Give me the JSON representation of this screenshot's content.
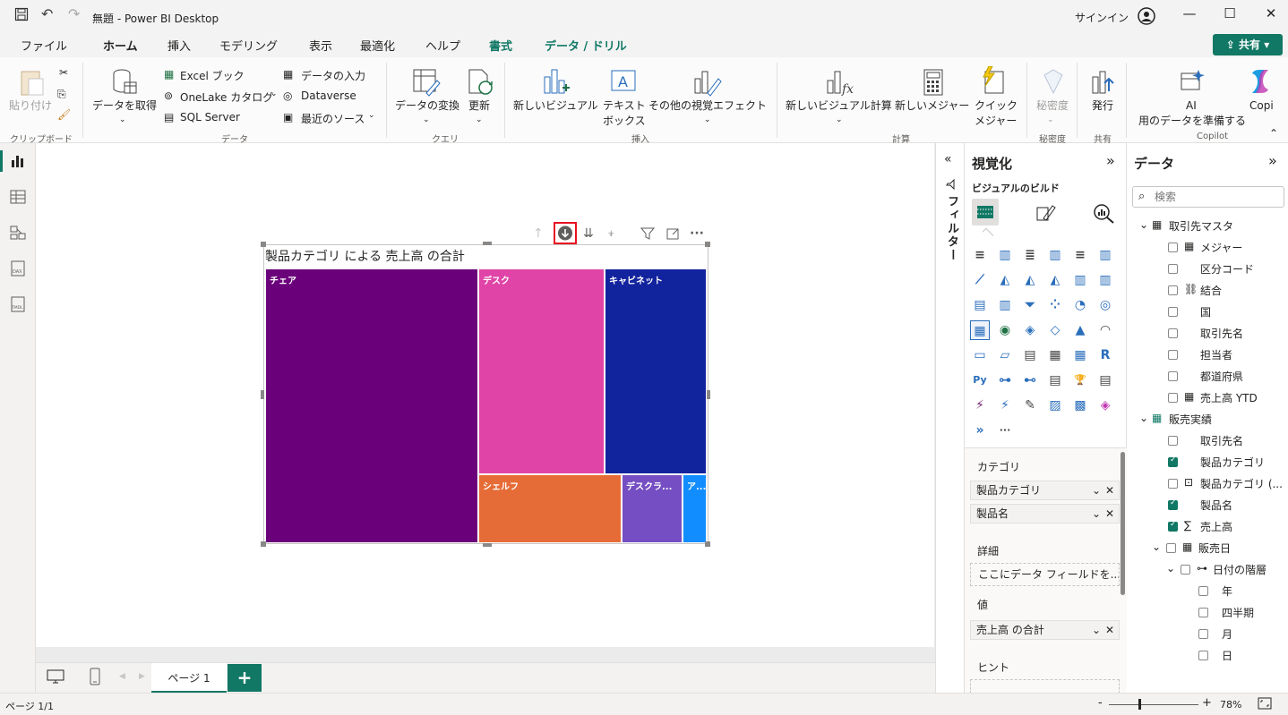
{
  "app": {
    "title": "無題 - Power BI Desktop",
    "signin": "サインイン"
  },
  "tabs": [
    "ファイル",
    "ホーム",
    "挿入",
    "モデリング",
    "表示",
    "最適化",
    "ヘルプ",
    "書式",
    "データ / ドリル"
  ],
  "share_label": "共有",
  "ribbon": {
    "paste": "貼り付け",
    "get_data": "データを取得",
    "excel": "Excel ブック",
    "onelake": "OneLake カタログ",
    "sql": "SQL Server",
    "enter_data": "データの入力",
    "dataverse": "Dataverse",
    "recent": "最近のソース",
    "transform": "データの変換",
    "refresh": "更新",
    "new_visual": "新しいビジュアル",
    "textbox_1": "テキスト",
    "textbox_2": "ボックス",
    "more_visuals": "その他の視覚エフェクト",
    "new_visual_calc": "新しいビジュアル計算",
    "new_measure": "新しいメジャー",
    "quick_measure_1": "クイック",
    "quick_measure_2": "メジャー",
    "sensitivity": "秘密度",
    "publish": "発行",
    "ai_1": "AI",
    "ai_2": "用のデータを準備する",
    "copilot": "Copi",
    "groups": {
      "clipboard": "クリップボード",
      "data": "データ",
      "query": "クエリ",
      "insert": "挿入",
      "calc": "計算",
      "sensitivity": "秘密度",
      "share": "共有",
      "copilot": "Copilot"
    }
  },
  "visual": {
    "title": "製品カテゴリ による 売上高 の合計",
    "tiles": [
      "チェア",
      "デスク",
      "キャビネット",
      "シェルフ",
      "デスクラ...",
      "ア..."
    ],
    "colors": [
      "#6b007b",
      "#e044a7",
      "#12239e",
      "#e66c37",
      "#744ec2",
      "#118dff"
    ]
  },
  "filter_pane": {
    "label": "フィルター"
  },
  "viz_pane": {
    "title": "視覚化",
    "build_label": "ビジュアルのビルド",
    "wells": {
      "category": "カテゴリ",
      "category_items": [
        "製品カテゴリ",
        "製品名"
      ],
      "details": "詳細",
      "details_placeholder": "ここにデータ フィールドを...",
      "values": "値",
      "values_items": [
        "売上高 の合計"
      ],
      "tooltips": "ヒント"
    }
  },
  "data_pane": {
    "title": "データ",
    "search_placeholder": "検索",
    "tables": [
      {
        "name": "取引先マスタ",
        "fields": [
          "メジャー",
          "区分コード",
          "結合",
          "国",
          "取引先名",
          "担当者",
          "都道府県",
          "売上高 YTD"
        ]
      },
      {
        "name": "販売実績",
        "fields": [
          "取引先名",
          "製品カテゴリ",
          "製品カテゴリ (...",
          "製品名",
          "売上高",
          "販売日",
          "日付の階層",
          "年",
          "四半期",
          "月",
          "日"
        ]
      }
    ]
  },
  "pages": {
    "tab": "ページ 1",
    "add": "+"
  },
  "status": {
    "page": "ページ 1/1",
    "zoom": "78%",
    "minus": "-",
    "plus": "+"
  }
}
